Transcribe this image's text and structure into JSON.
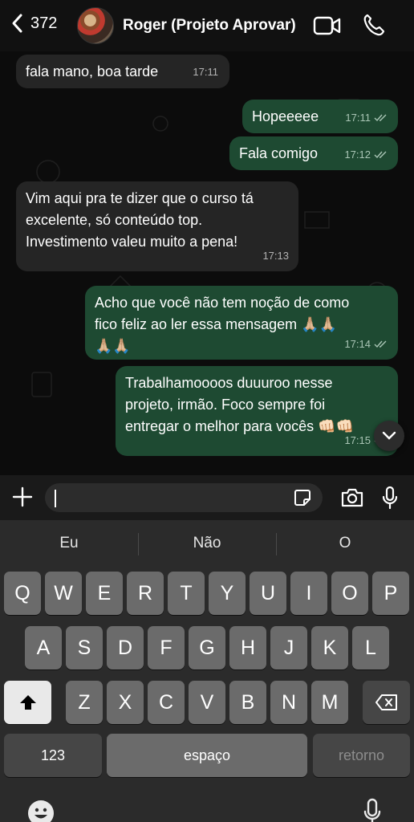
{
  "header": {
    "back_count": "372",
    "contact_name": "Roger (Projeto Aprovar)",
    "icons": [
      "chevron-left-icon",
      "video-call-icon",
      "phone-icon"
    ]
  },
  "messages": [
    {
      "direction": "in",
      "text": "fala mano, boa tarde",
      "time": "17:11"
    },
    {
      "direction": "out",
      "text": "Hopeeeee",
      "time": "17:11",
      "status": "read"
    },
    {
      "direction": "out",
      "text": "Fala comigo",
      "time": "17:12",
      "status": "read"
    },
    {
      "direction": "in",
      "text": "Vim aqui pra te dizer que o curso tá\nexcelente, só conteúdo top.\nInvestimento valeu muito a pena!",
      "time": "17:13"
    },
    {
      "direction": "out",
      "text": "Acho que você não tem noção de como\nfico feliz ao ler essa mensagem 🙏🏼🙏🏼\n🙏🏼🙏🏼",
      "time": "17:14",
      "status": "read"
    },
    {
      "direction": "out",
      "text": "Trabalhamoooos duuuroo nesse\nprojeto, irmão. Foco sempre foi\nentregar o melhor para vocês 👊🏻👊🏻",
      "time": "17:15",
      "status": "read"
    }
  ],
  "composer": {
    "value": "",
    "icons": [
      "plus-icon",
      "sticker-icon",
      "camera-icon",
      "microphone-icon"
    ]
  },
  "keyboard": {
    "suggestions": [
      "Eu",
      "Não",
      "O"
    ],
    "row1": [
      "Q",
      "W",
      "E",
      "R",
      "T",
      "Y",
      "U",
      "I",
      "O",
      "P"
    ],
    "row2": [
      "A",
      "S",
      "D",
      "F",
      "G",
      "H",
      "J",
      "K",
      "L"
    ],
    "row3": [
      "Z",
      "X",
      "C",
      "V",
      "B",
      "N",
      "M"
    ],
    "numbers_label": "123",
    "space_label": "espaço",
    "return_label": "retorno",
    "icons": [
      "shift-icon",
      "backspace-icon",
      "emoji-icon",
      "dictation-icon"
    ]
  },
  "colors": {
    "incoming_bubble": "#252525",
    "outgoing_bubble": "#1e4a32",
    "background": "#0c0c0c"
  }
}
